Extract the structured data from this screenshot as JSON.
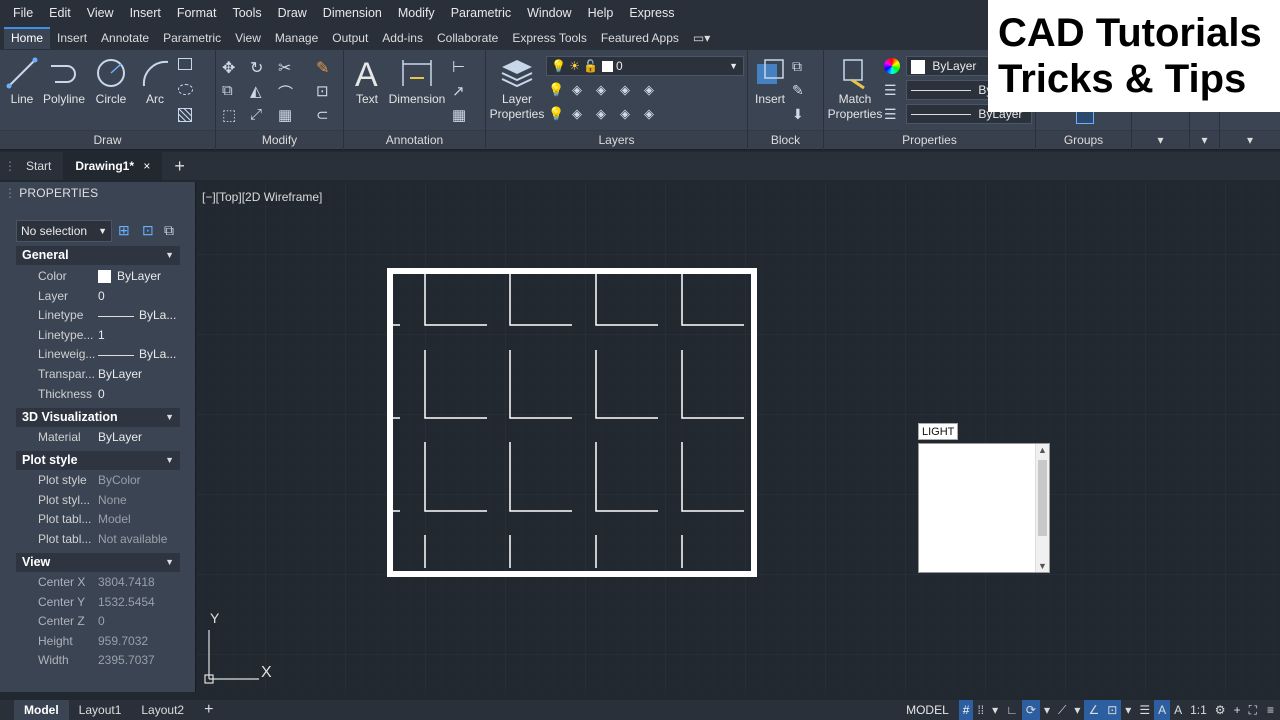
{
  "menubar": [
    "File",
    "Edit",
    "View",
    "Insert",
    "Format",
    "Tools",
    "Draw",
    "Dimension",
    "Modify",
    "Parametric",
    "Window",
    "Help",
    "Express"
  ],
  "ribbon_tabs": [
    "Home",
    "Insert",
    "Annotate",
    "Parametric",
    "View",
    "Manage",
    "Output",
    "Add-ins",
    "Collaborate",
    "Express Tools",
    "Featured Apps"
  ],
  "ribbon": {
    "draw": {
      "line": "Line",
      "polyline": "Polyline",
      "circle": "Circle",
      "arc": "Arc",
      "label": "Draw"
    },
    "modify": {
      "label": "Modify"
    },
    "annotation": {
      "text": "Text",
      "dimension": "Dimension",
      "label": "Annotation"
    },
    "layers": {
      "layer_properties": "Layer\nProperties",
      "current_layer": "0",
      "label": "Layers"
    },
    "block": {
      "insert": "Insert",
      "label": "Block"
    },
    "properties": {
      "match": "Match\nProperties",
      "color": "ByLayer",
      "linetype": "ByL",
      "lineweight": "ByLayer",
      "label": "Properties"
    },
    "groups": {
      "label": "Groups"
    }
  },
  "overlay": {
    "line1": "CAD Tutorials",
    "line2": "Tricks & Tips"
  },
  "file_tabs": {
    "start": "Start",
    "drawing": "Drawing1*",
    "close": "×",
    "add": "+"
  },
  "properties_palette": {
    "title": "PROPERTIES",
    "selection": "No selection",
    "general": {
      "title": "General",
      "rows": [
        {
          "name": "Color",
          "value": "ByLayer"
        },
        {
          "name": "Layer",
          "value": "0"
        },
        {
          "name": "Linetype",
          "value": "ByLa..."
        },
        {
          "name": "Linetype...",
          "value": "1"
        },
        {
          "name": "Lineweig...",
          "value": "ByLa..."
        },
        {
          "name": "Transpar...",
          "value": "ByLayer"
        },
        {
          "name": "Thickness",
          "value": "0"
        }
      ]
    },
    "viz": {
      "title": "3D Visualization",
      "rows": [
        {
          "name": "Material",
          "value": "ByLayer"
        }
      ]
    },
    "plot": {
      "title": "Plot style",
      "rows": [
        {
          "name": "Plot style",
          "value": "ByColor"
        },
        {
          "name": "Plot styl...",
          "value": "None"
        },
        {
          "name": "Plot tabl...",
          "value": "Model"
        },
        {
          "name": "Plot tabl...",
          "value": "Not available"
        }
      ]
    },
    "view": {
      "title": "View",
      "rows": [
        {
          "name": "Center X",
          "value": "3804.7418"
        },
        {
          "name": "Center Y",
          "value": "1532.5454"
        },
        {
          "name": "Center Z",
          "value": "0"
        },
        {
          "name": "Height",
          "value": "959.7032"
        },
        {
          "name": "Width",
          "value": "2395.7037"
        }
      ]
    }
  },
  "viewport_label": "[−][Top][2D Wireframe]",
  "ucs": {
    "x": "X",
    "y": "Y"
  },
  "command": {
    "typed": "LIGHT"
  },
  "layout_tabs": [
    "Model",
    "Layout1",
    "Layout2"
  ],
  "status": {
    "model": "MODEL",
    "scale": "1:1"
  },
  "colors": {
    "bg": "#212830",
    "panel": "#3b4453",
    "accent": "#3f8ee8"
  }
}
